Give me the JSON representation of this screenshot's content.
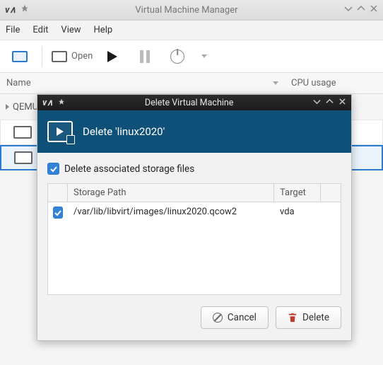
{
  "window": {
    "title": "Virtual Machine Manager"
  },
  "menu": {
    "file": "File",
    "edit": "Edit",
    "view": "View",
    "help": "Help"
  },
  "toolbar": {
    "open_label": "Open"
  },
  "listhdr": {
    "name": "Name",
    "cpu": "CPU usage"
  },
  "host": {
    "label": "QEMU"
  },
  "dialog": {
    "title": "Delete Virtual Machine",
    "banner": "Delete 'linux2020'",
    "check_label": "Delete associated storage files",
    "table": {
      "h_path": "Storage Path",
      "h_target": "Target",
      "rows": [
        {
          "path": "/var/lib/libvirt/images/linux2020.qcow2",
          "target": "vda"
        }
      ]
    },
    "cancel": "Cancel",
    "delete": "Delete"
  }
}
